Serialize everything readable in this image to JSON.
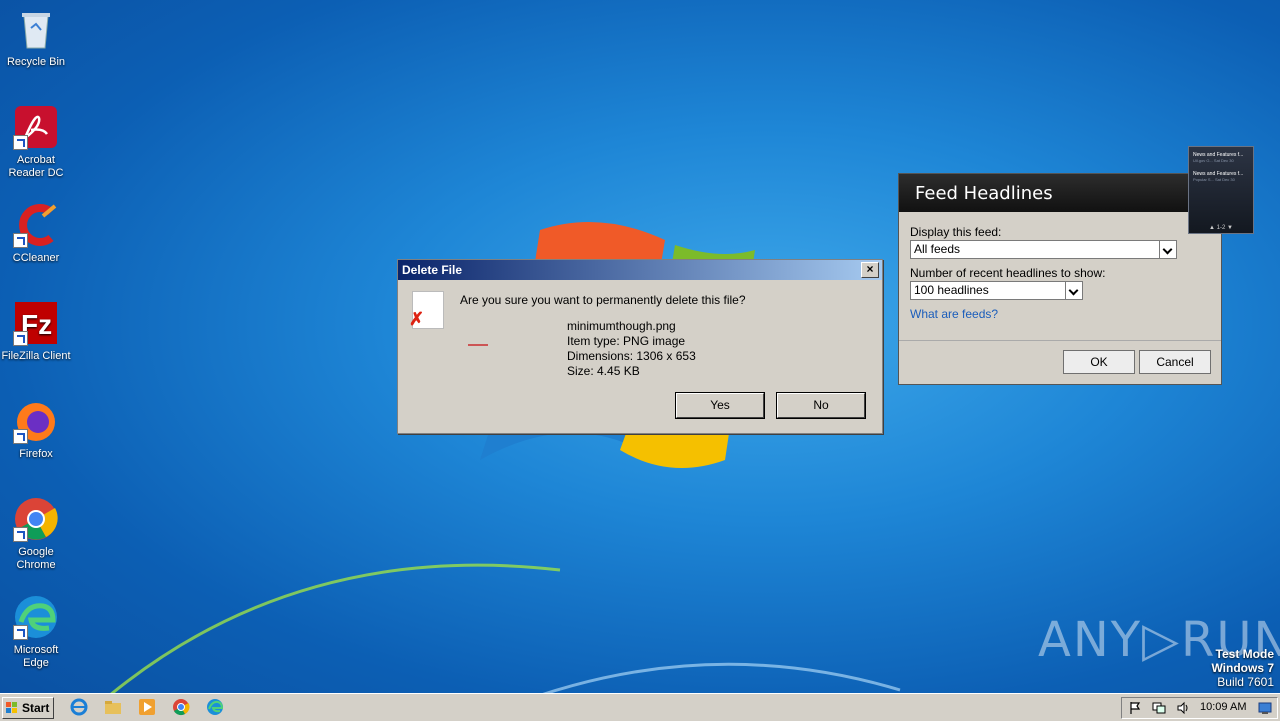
{
  "desktop": {
    "icons": [
      {
        "label": "Recycle Bin",
        "icon": "recycle-bin-icon"
      },
      {
        "label": "Acrobat Reader DC",
        "icon": "acrobat-icon"
      },
      {
        "label": "CCleaner",
        "icon": "ccleaner-icon"
      },
      {
        "label": "FileZilla Client",
        "icon": "filezilla-icon"
      },
      {
        "label": "Firefox",
        "icon": "firefox-icon"
      },
      {
        "label": "Google Chrome",
        "icon": "chrome-icon"
      },
      {
        "label": "Microsoft Edge",
        "icon": "edge-icon"
      }
    ],
    "watermark": "ANY▷RUN",
    "test_mode": {
      "line1": "Test Mode",
      "line2": "Windows 7",
      "line3": "Build 7601"
    }
  },
  "delete_dialog": {
    "title": "Delete File",
    "close": "×",
    "question": "Are you sure you want to permanently delete this file?",
    "file_name": "minimumthough.png",
    "item_type": "Item type: PNG image",
    "dimensions": "Dimensions: 1306 x 653",
    "size": "Size: 4.45 KB",
    "yes_label": "Yes",
    "no_label": "No"
  },
  "feed_dialog": {
    "title": "Feed Headlines",
    "display_label": "Display this feed:",
    "display_value": "All feeds",
    "count_label": "Number of recent headlines to show:",
    "count_value": "100 headlines",
    "link": "What are feeds?",
    "ok_label": "OK",
    "cancel_label": "Cancel"
  },
  "gadget": {
    "items": [
      {
        "title": "News and Features f...",
        "sub": "Uil.gov G...    Sat Dec 30"
      },
      {
        "title": "News and Features f...",
        "sub": "Popular S...    Sat Dec 30"
      }
    ],
    "pager": "1-2"
  },
  "taskbar": {
    "start_label": "Start",
    "clock": "10:09 AM",
    "colors": {
      "accent": "#0a246a",
      "desktop": "#1e86d6"
    }
  }
}
